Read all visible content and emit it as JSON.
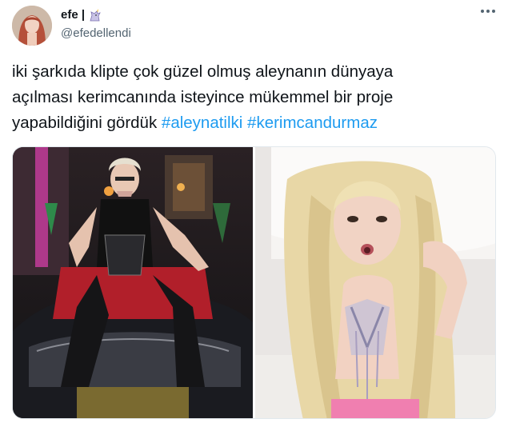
{
  "user": {
    "display_name": "efe |",
    "handle": "@efedellendi",
    "badge_icon": "unicorn-icon"
  },
  "tweet": {
    "text_lines": [
      "iki şarkıda klipte çok güzel olmuş aleynanın dünyaya",
      "açılması kerimcanında isteyince mükemmel bir proje",
      "yapabildiğini gördük"
    ],
    "hashtags": [
      "#aleynatilki",
      "#kerimcandurmaz"
    ]
  },
  "colors": {
    "hashtag": "#1d9bf0",
    "text": "#0f1419",
    "secondary": "#536471"
  }
}
